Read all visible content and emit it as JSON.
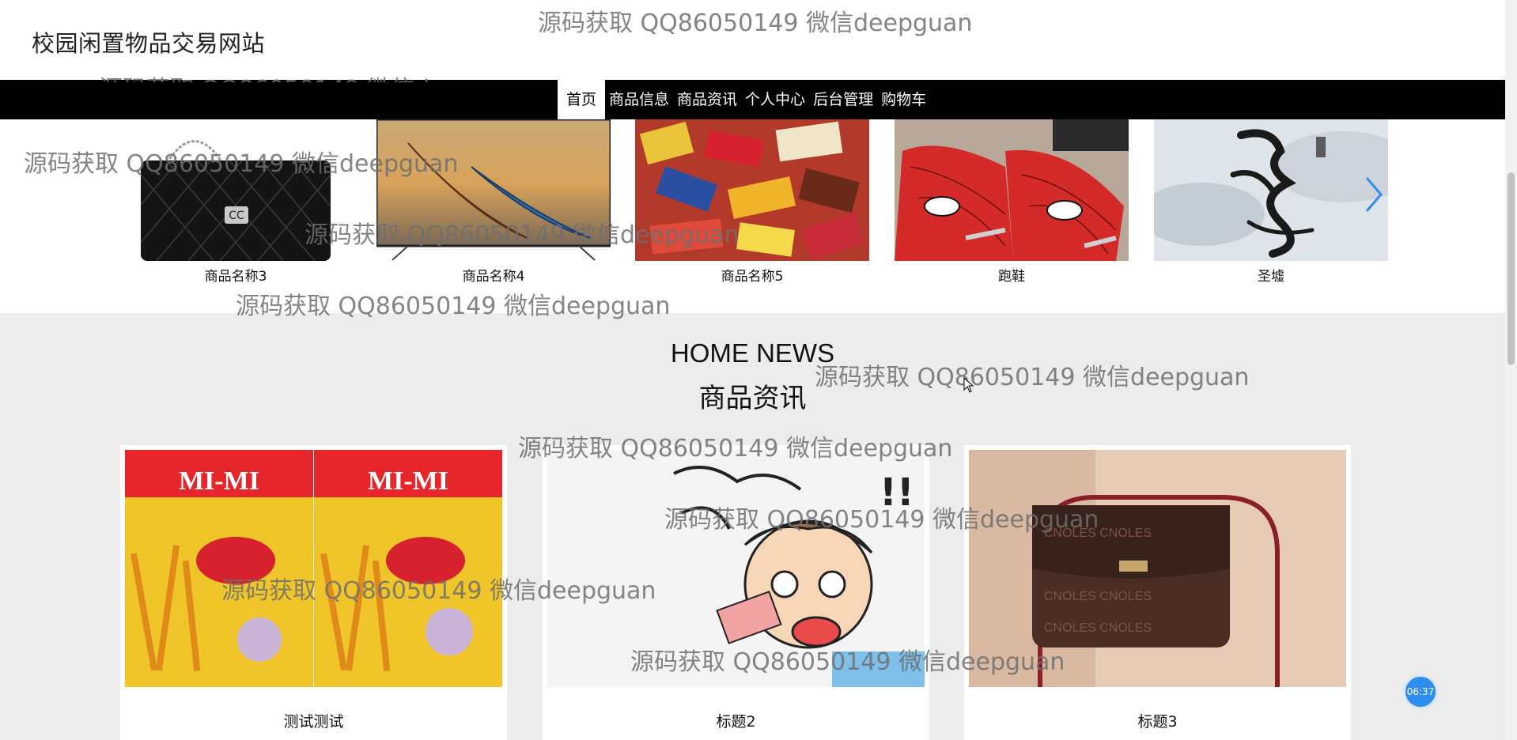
{
  "header": {
    "site_title": "校园闲置物品交易网站"
  },
  "nav": {
    "items": [
      {
        "label": "首页",
        "active": true
      },
      {
        "label": "商品信息",
        "active": false
      },
      {
        "label": "商品资讯",
        "active": false
      },
      {
        "label": "个人中心",
        "active": false
      },
      {
        "label": "后台管理",
        "active": false
      },
      {
        "label": "购物车",
        "active": false
      }
    ]
  },
  "carousel": {
    "items": [
      {
        "caption": "商品名称3",
        "image": "black-quilted-handbag"
      },
      {
        "caption": "商品名称4",
        "image": "kayaks-on-tv"
      },
      {
        "caption": "商品名称5",
        "image": "pile-of-snacks"
      },
      {
        "caption": "跑鞋",
        "image": "red-spiderman-sneakers"
      },
      {
        "caption": "圣墟",
        "image": "book-cover-calligraphy"
      }
    ],
    "prev_icon": "chevron-left-icon",
    "next_icon": "chevron-right-icon"
  },
  "news": {
    "title_en": "HOME NEWS",
    "title_cn": "商品资讯",
    "items": [
      {
        "title": "测试测试",
        "image": "mimi-snack-bags"
      },
      {
        "title": "标题2",
        "image": "cartoon-boy-money"
      },
      {
        "title": "标题3",
        "image": "brown-crossbody-bag"
      }
    ]
  },
  "watermark": {
    "text": "源码获取 QQ86050149 微信deepguan",
    "partial_text": "源码获取 QQ86050149 微信deep"
  },
  "timer": {
    "label": "06:37"
  },
  "colors": {
    "navbar_bg": "#000000",
    "page_bg": "#ececec",
    "accent": "#2f8df0"
  }
}
